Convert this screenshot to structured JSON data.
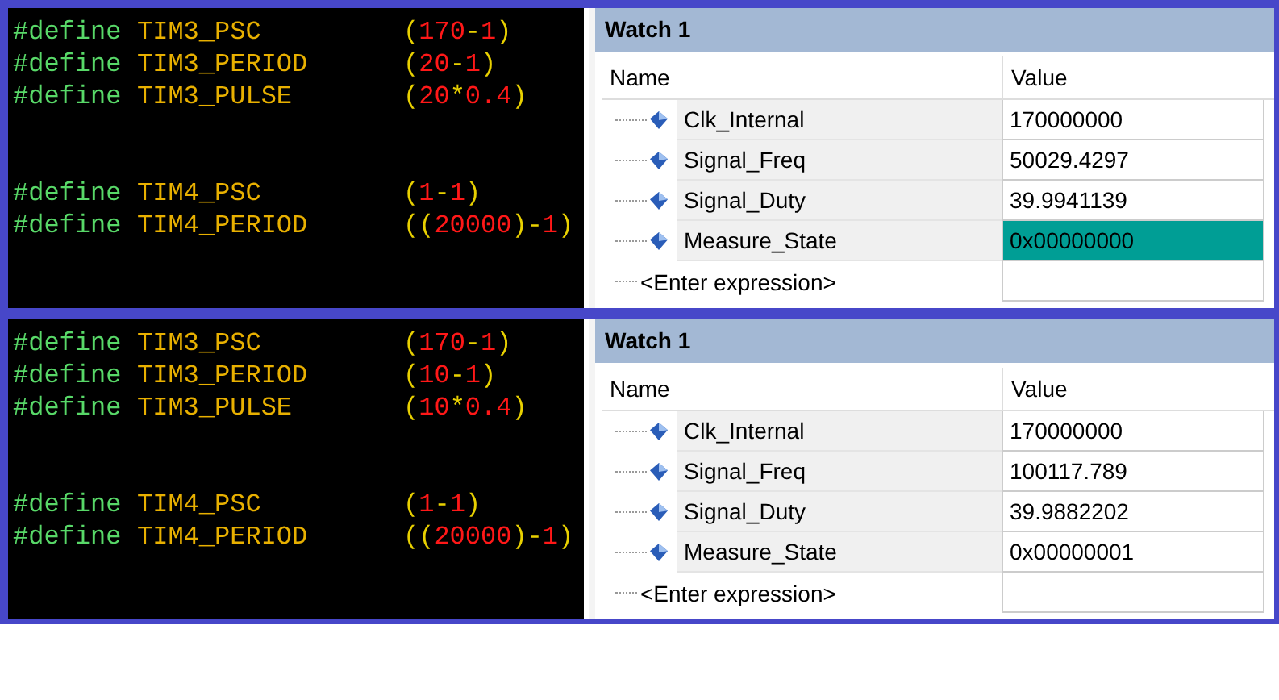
{
  "panels": [
    {
      "code": {
        "blocks": [
          [
            {
              "keyword": "#define",
              "name": "TIM3_PSC",
              "value": "(170-1)"
            },
            {
              "keyword": "#define",
              "name": "TIM3_PERIOD",
              "value": "(20-1)"
            },
            {
              "keyword": "#define",
              "name": "TIM3_PULSE",
              "value": "(20*0.4)"
            }
          ],
          [
            {
              "keyword": "#define",
              "name": "TIM4_PSC",
              "value": "(1-1)"
            },
            {
              "keyword": "#define",
              "name": "TIM4_PERIOD",
              "value": "((20000)-1)"
            }
          ]
        ]
      },
      "watch": {
        "title": "Watch 1",
        "columns": [
          "Name",
          "Value"
        ],
        "rows": [
          {
            "name": "Clk_Internal",
            "value": "170000000",
            "highlighted": false
          },
          {
            "name": "Signal_Freq",
            "value": "50029.4297",
            "highlighted": false
          },
          {
            "name": "Signal_Duty",
            "value": "39.9941139",
            "highlighted": false
          },
          {
            "name": "Measure_State",
            "value": "0x00000000",
            "highlighted": true
          }
        ],
        "entry": "<Enter expression>"
      }
    },
    {
      "code": {
        "blocks": [
          [
            {
              "keyword": "#define",
              "name": "TIM3_PSC",
              "value": "(170-1)"
            },
            {
              "keyword": "#define",
              "name": "TIM3_PERIOD",
              "value": "(10-1)"
            },
            {
              "keyword": "#define",
              "name": "TIM3_PULSE",
              "value": "(10*0.4)"
            }
          ],
          [
            {
              "keyword": "#define",
              "name": "TIM4_PSC",
              "value": "(1-1)"
            },
            {
              "keyword": "#define",
              "name": "TIM4_PERIOD",
              "value": "((20000)-1)"
            }
          ]
        ]
      },
      "watch": {
        "title": "Watch 1",
        "columns": [
          "Name",
          "Value"
        ],
        "rows": [
          {
            "name": "Clk_Internal",
            "value": "170000000",
            "highlighted": false
          },
          {
            "name": "Signal_Freq",
            "value": "100117.789",
            "highlighted": false
          },
          {
            "name": "Signal_Duty",
            "value": "39.9882202",
            "highlighted": false
          },
          {
            "name": "Measure_State",
            "value": "0x00000001",
            "highlighted": false
          }
        ],
        "entry": "<Enter expression>"
      }
    }
  ]
}
